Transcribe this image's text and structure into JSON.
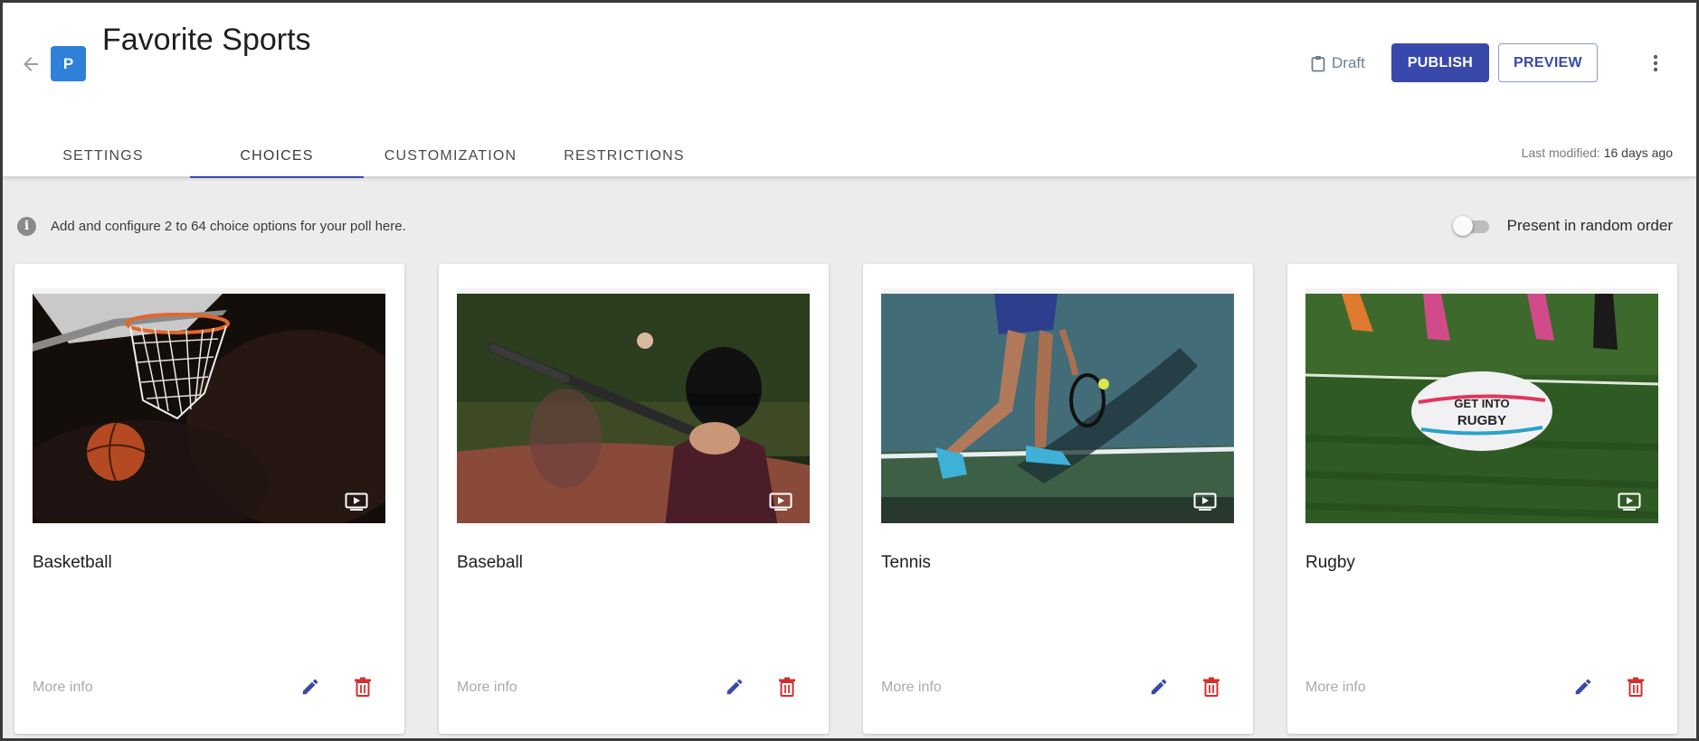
{
  "header": {
    "app_badge": "P",
    "title": "Favorite Sports",
    "status_icon": "clipboard-icon",
    "status": "Draft",
    "publish_label": "PUBLISH",
    "preview_label": "PREVIEW",
    "menu_icon": "more-vert-icon"
  },
  "tabs": [
    {
      "label": "SETTINGS",
      "active": false
    },
    {
      "label": "CHOICES",
      "active": true
    },
    {
      "label": "CUSTOMIZATION",
      "active": false
    },
    {
      "label": "RESTRICTIONS",
      "active": false
    }
  ],
  "last_modified": {
    "label": "Last modified:",
    "value": "16 days ago"
  },
  "info": {
    "icon": "info-icon",
    "text": "Add and configure 2 to 64 choice options for your poll here."
  },
  "random_order": {
    "label": "Present in random order",
    "enabled": false
  },
  "choices": [
    {
      "title": "Basketball",
      "more_info": "More info",
      "image": "basketball-hoop-photo",
      "media_icon": "video-icon"
    },
    {
      "title": "Baseball",
      "more_info": "More info",
      "image": "baseball-batter-photo",
      "media_icon": "video-icon"
    },
    {
      "title": "Tennis",
      "more_info": "More info",
      "image": "tennis-player-photo",
      "media_icon": "video-icon"
    },
    {
      "title": "Rugby",
      "more_info": "More info",
      "image": "rugby-ball-photo",
      "media_icon": "video-icon"
    }
  ],
  "colors": {
    "accent": "#3949ab",
    "badge": "#2f80d8",
    "delete": "#d32f2f",
    "background": "#ececec"
  }
}
